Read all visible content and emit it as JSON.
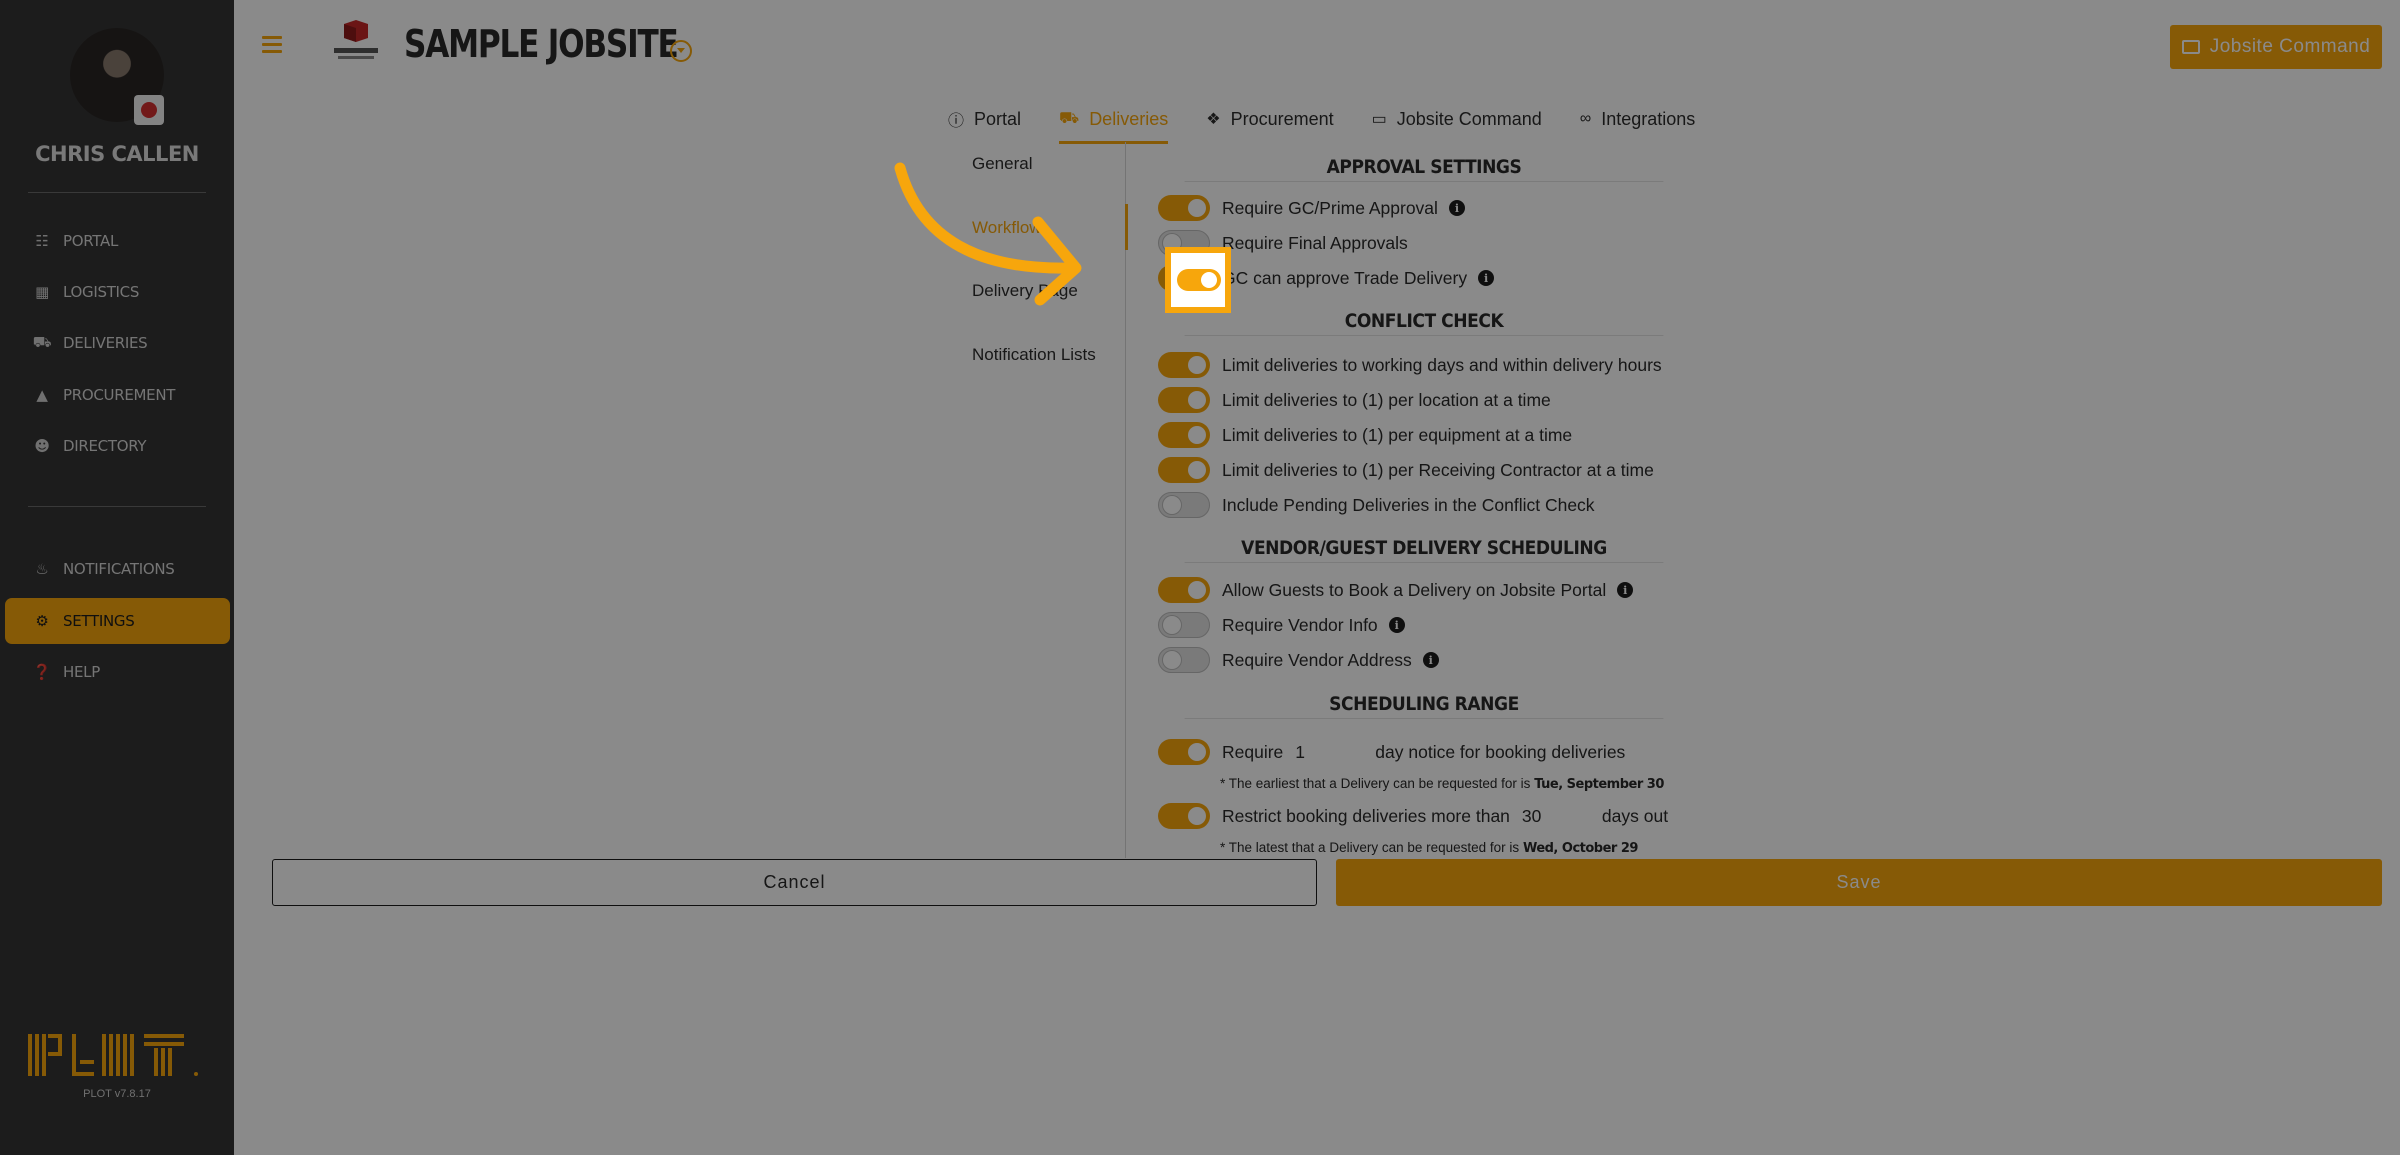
{
  "sidebar": {
    "user_name": "CHRIS CALLEN",
    "items": [
      {
        "label": "PORTAL",
        "icon": "sitemap-icon"
      },
      {
        "label": "LOGISTICS",
        "icon": "map-icon"
      },
      {
        "label": "DELIVERIES",
        "icon": "truck-icon"
      },
      {
        "label": "PROCUREMENT",
        "icon": "boxes-icon"
      },
      {
        "label": "DIRECTORY",
        "icon": "users-icon"
      },
      {
        "label": "NOTIFICATIONS",
        "icon": "bell-icon"
      },
      {
        "label": "SETTINGS",
        "icon": "gear-icon",
        "active": true
      },
      {
        "label": "HELP",
        "icon": "help-icon"
      }
    ],
    "version": "PLOT v7.8.17"
  },
  "header": {
    "site_title": "SAMPLE JOBSITE",
    "command_button": "Jobsite Command"
  },
  "tabs": [
    {
      "label": "Portal",
      "icon": "info-icon"
    },
    {
      "label": "Deliveries",
      "icon": "truck-icon",
      "active": true
    },
    {
      "label": "Procurement",
      "icon": "puzzle-icon"
    },
    {
      "label": "Jobsite Command",
      "icon": "monitor-icon"
    },
    {
      "label": "Integrations",
      "icon": "link-icon"
    }
  ],
  "subnav": [
    {
      "label": "General"
    },
    {
      "label": "Workflow",
      "active": true
    },
    {
      "label": "Delivery Page"
    },
    {
      "label": "Notification Lists"
    }
  ],
  "sections": {
    "approval": {
      "title": "APPROVAL SETTINGS",
      "rows": [
        {
          "label": "Require GC/Prime Approval",
          "on": true
        },
        {
          "label": "Require Final Approvals",
          "on": false
        },
        {
          "label": "GC can approve Trade Delivery",
          "on": true
        }
      ]
    },
    "conflict": {
      "title": "CONFLICT CHECK",
      "rows": [
        {
          "label": "Limit deliveries to working days and within delivery hours",
          "on": true
        },
        {
          "label": "Limit deliveries to (1) per location at a time",
          "on": true
        },
        {
          "label": "Limit deliveries to (1) per equipment at a time",
          "on": true
        },
        {
          "label": "Limit deliveries to (1) per Receiving Contractor at a time",
          "on": true
        },
        {
          "label": "Include Pending Deliveries in the Conflict Check",
          "on": false
        }
      ]
    },
    "vendor": {
      "title": "VENDOR/GUEST DELIVERY SCHEDULING",
      "rows": [
        {
          "label": "Allow Guests to Book a Delivery on Jobsite Portal",
          "on": true
        },
        {
          "label": "Require Vendor Info",
          "on": false
        },
        {
          "label": "Require Vendor Address",
          "on": false
        }
      ]
    },
    "range": {
      "title": "SCHEDULING RANGE",
      "notice_prefix": "Require",
      "notice_value": "1",
      "notice_suffix": "day notice for booking deliveries",
      "earliest_note": "* The earliest that a Delivery can be requested for is",
      "earliest_date": "Tue, September 30",
      "restrict_prefix": "Restrict booking deliveries more than",
      "restrict_value": "30",
      "restrict_suffix": "days out",
      "latest_note": "* The latest that a Delivery can be requested for is",
      "latest_date": "Wed, October 29"
    }
  },
  "buttons": {
    "cancel": "Cancel",
    "save": "Save"
  },
  "colors": {
    "accent": "#f7a60c",
    "sidebar_bg": "#343434"
  }
}
